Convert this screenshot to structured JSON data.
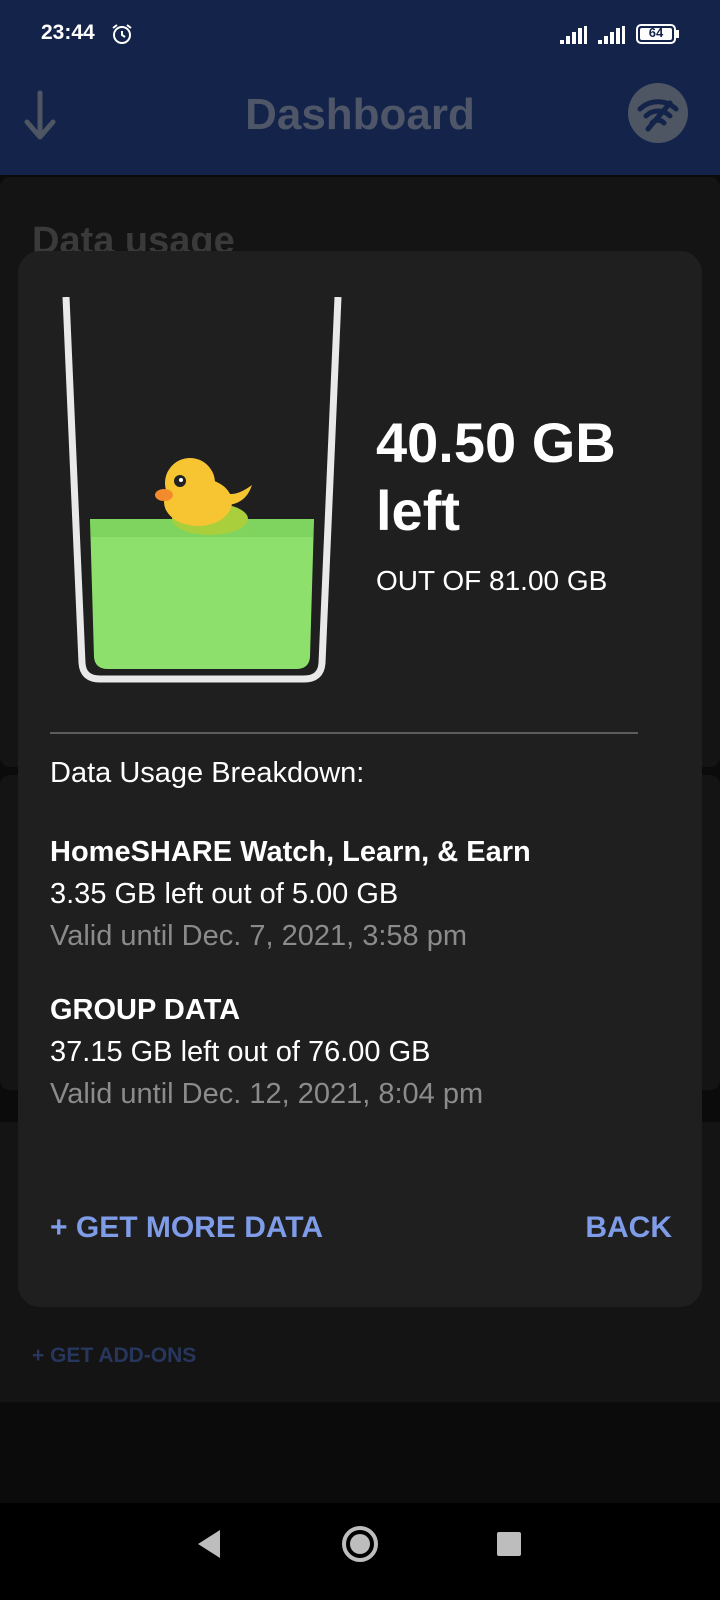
{
  "status_bar": {
    "time": "23:44",
    "battery": "64"
  },
  "app_bar": {
    "title": "Dashboard"
  },
  "background": {
    "heading": "Data usage",
    "add_ons": "+ GET ADD-ONS"
  },
  "dialog": {
    "remaining_amount": "40.50 GB",
    "remaining_suffix": "left",
    "total": "OUT OF 81.00 GB",
    "remaining_fraction": 0.5,
    "breakdown_title": "Data Usage Breakdown:",
    "plans": [
      {
        "name": "HomeSHARE Watch, Learn, & Earn",
        "left": "3.35 GB left out of 5.00 GB",
        "valid": "Valid until Dec. 7, 2021, 3:58 pm"
      },
      {
        "name": "GROUP DATA",
        "left": "37.15 GB left out of 76.00 GB",
        "valid": "Valid until Dec. 12, 2021, 8:04 pm"
      }
    ],
    "get_more_label": "+ GET MORE DATA",
    "back_label": "BACK"
  },
  "icons": {
    "alarm": "alarm-icon",
    "signal": "signal-icon",
    "back_arrow": "arrow-down-icon",
    "wifi": "wifi-off-icon",
    "mascot": "duck-icon"
  },
  "colors": {
    "app_bar": "#13234a",
    "dialog": "#1f1f20",
    "accent": "#7f9ce8",
    "water": "#8ee06c"
  }
}
